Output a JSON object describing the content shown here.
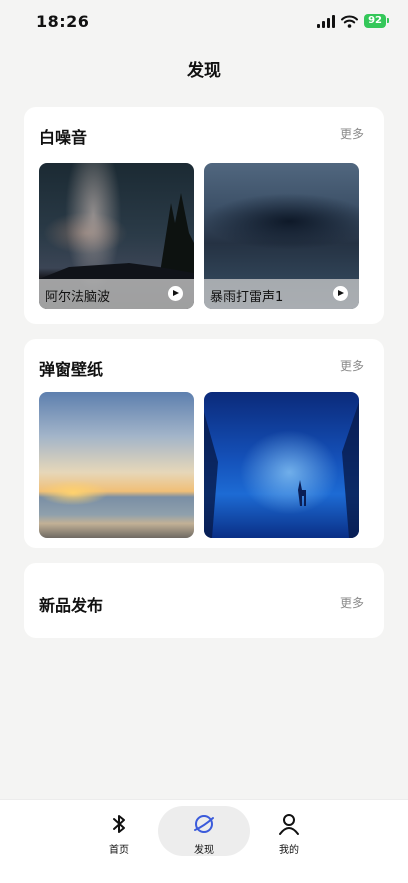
{
  "status": {
    "time": "18:26",
    "battery": "92"
  },
  "page": {
    "title": "发现"
  },
  "sections": {
    "white_noise": {
      "title": "白噪音",
      "more": "更多",
      "items": [
        {
          "caption": "阿尔法脑波"
        },
        {
          "caption": "暴雨打雷声1"
        }
      ]
    },
    "wallpaper": {
      "title": "弹窗壁纸",
      "more": "更多"
    },
    "new_release": {
      "title": "新品发布",
      "more": "更多"
    }
  },
  "tabbar": {
    "items": [
      {
        "label": "首页",
        "icon": "bluetooth-icon"
      },
      {
        "label": "发现",
        "icon": "planet-icon"
      },
      {
        "label": "我的",
        "icon": "person-icon"
      }
    ],
    "active": "发现",
    "accent": "#3b5bdb"
  }
}
